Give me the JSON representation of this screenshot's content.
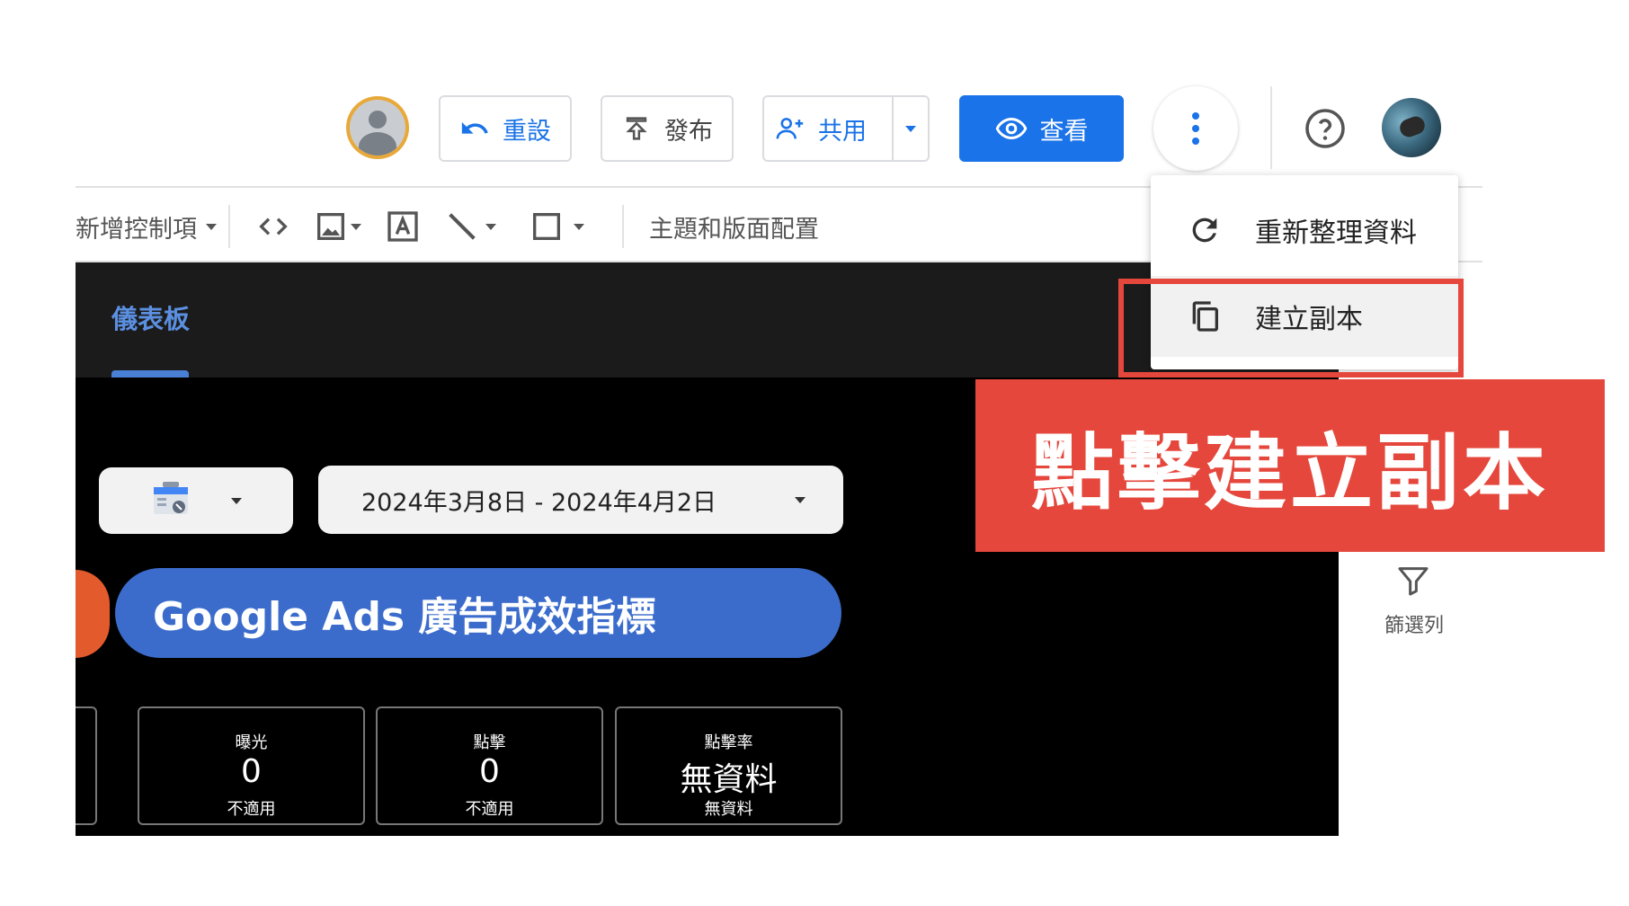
{
  "header": {
    "reset_label": "重設",
    "publish_label": "發布",
    "share_label": "共用",
    "view_label": "查看"
  },
  "toolbar": {
    "add_control_label": "新增控制項",
    "theme_label": "主題和版面配置"
  },
  "nav": {
    "tab_label": "儀表板"
  },
  "controls": {
    "date_range": "2024年3月8日 - 2024年4月2日"
  },
  "banner": {
    "title": "Google Ads 廣告成效指標"
  },
  "kpis": [
    {
      "label": "曝光",
      "value": "0",
      "sub": "不適用"
    },
    {
      "label": "點擊",
      "value": "0",
      "sub": "不適用"
    },
    {
      "label": "點擊率",
      "value": "無資料",
      "sub": "無資料"
    }
  ],
  "side_panel": {
    "filter_label": "篩選列"
  },
  "menu": {
    "items": [
      {
        "label": "重新整理資料",
        "icon": "refresh-icon"
      },
      {
        "label": "建立副本",
        "icon": "copy-icon"
      }
    ]
  },
  "callout": {
    "text": "點擊建立副本"
  },
  "colors": {
    "primary_blue": "#1a73e8",
    "banner_blue": "#3b6ccc",
    "callout_red": "#e5473c",
    "accent_orange": "#e35a2c"
  }
}
